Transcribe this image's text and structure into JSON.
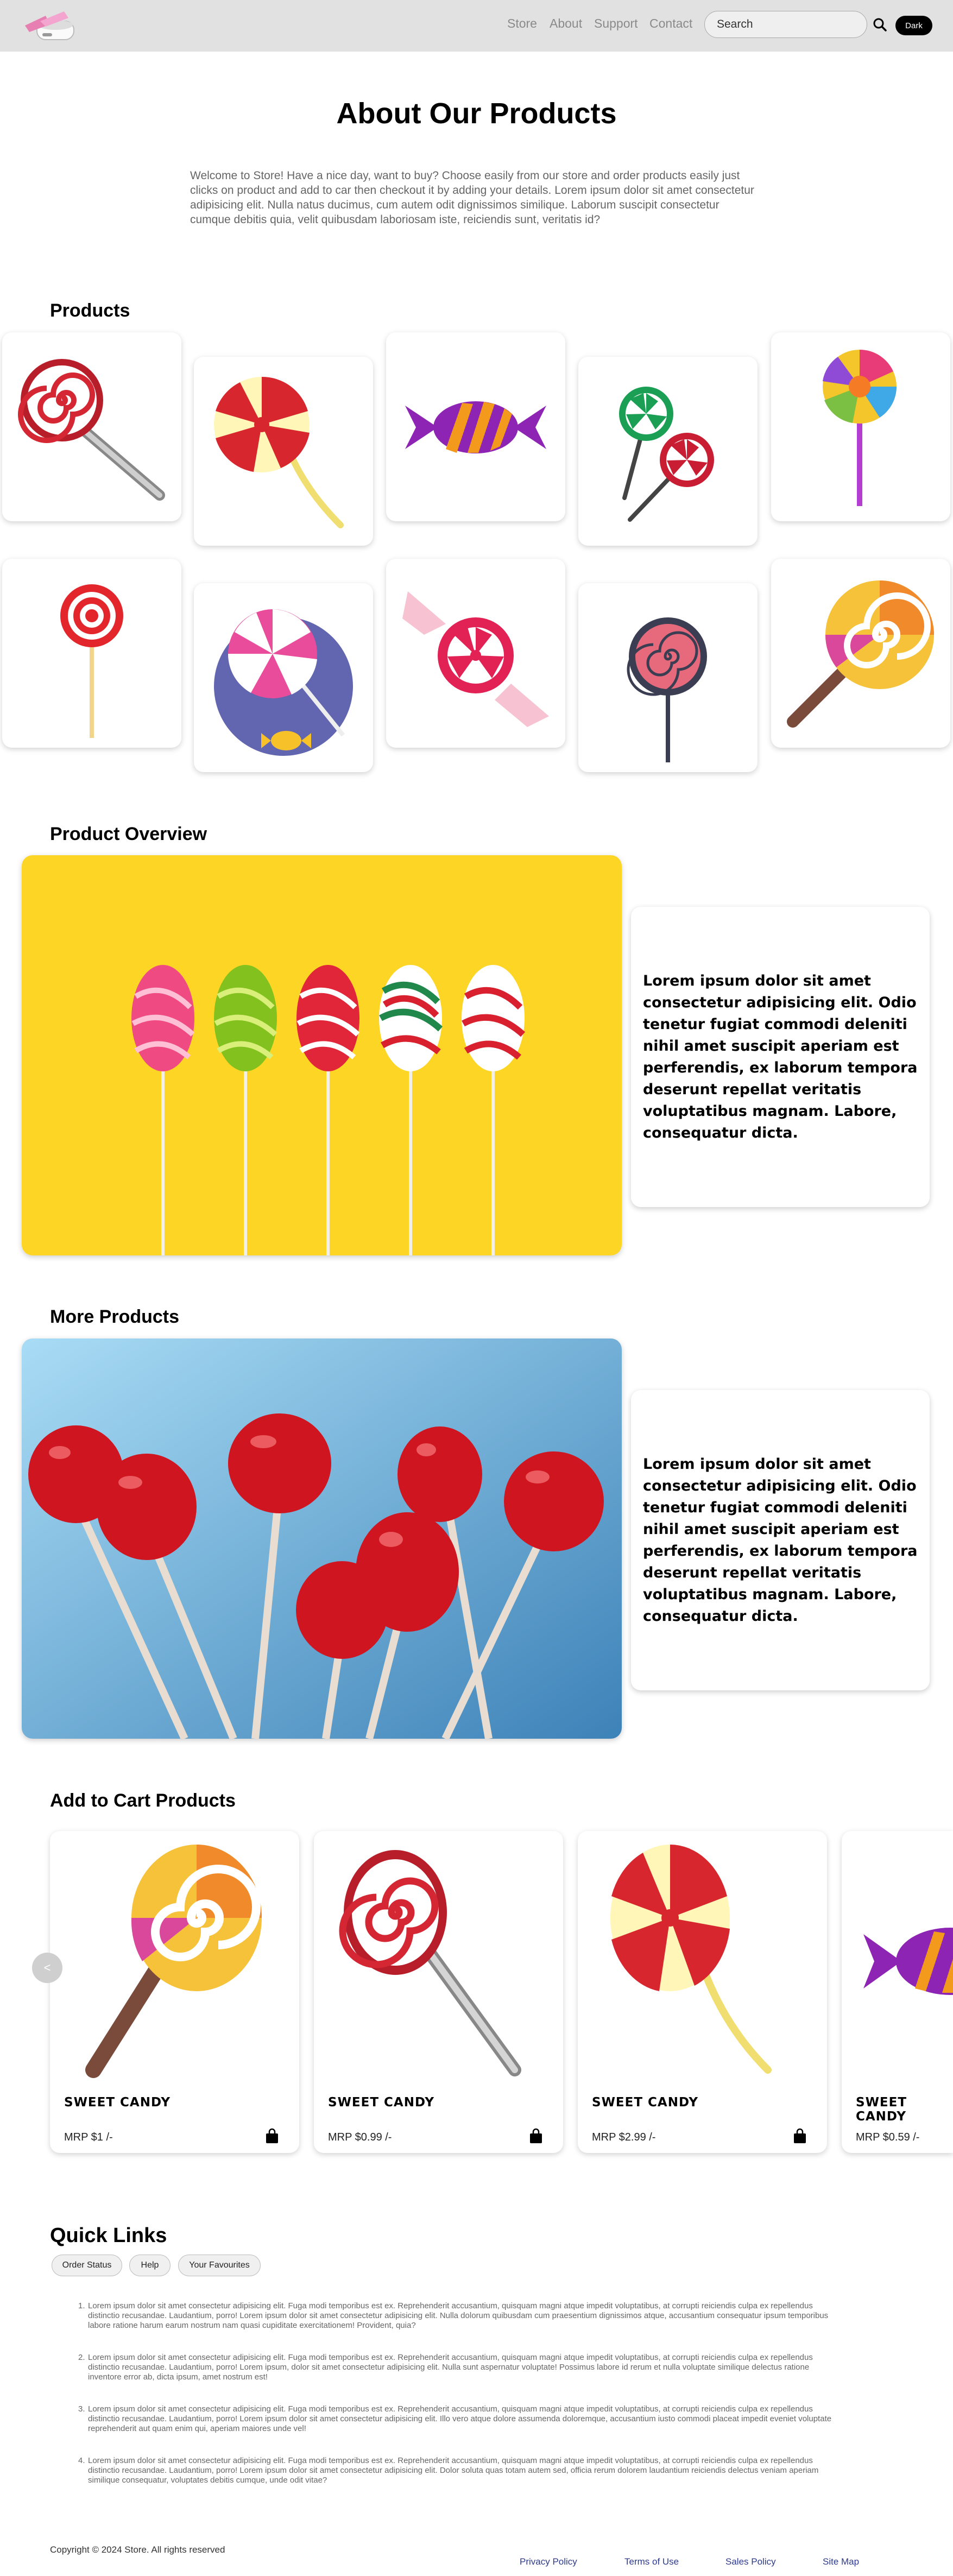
{
  "navbar": {
    "links": [
      "Store",
      "About",
      "Support",
      "Contact"
    ],
    "search_placeholder": "Search",
    "dark_label": "Dark",
    "logo_icon": "cart-logo-icon",
    "search_icon": "magnifier-icon"
  },
  "about": {
    "title": "About Our Products",
    "text": "Welcome to Store! Have a nice day, want to buy? Choose easily from our store and order products easily just clicks on product and add to car then checkout it by adding your details. Lorem ipsum dolor sit amet consectetur adipisicing elit. Nulla natus ducimus, cum autem odit dignissimos similique. Laborum suscipit consectetur cumque debitis quia, velit quibusdam laboriosam iste, reiciendis sunt, veritatis id?"
  },
  "products": {
    "title": "Products",
    "items": [
      "swirl-lollipop-large-icon",
      "yellow-red-swirl-lollipop-icon",
      "purple-wrapped-candy-icon",
      "green-red-lollipops-icon",
      "rainbow-lollipop-icon",
      "small-red-lollipop-icon",
      "pink-lollipop-plate-icon",
      "pink-wrapped-candy-icon",
      "dark-spiral-lollipop-icon",
      "orange-swirl-lollipop-icon"
    ]
  },
  "overview": {
    "title": "Product Overview",
    "text": "Lorem ipsum dolor sit amet consectetur adipisicing elit. Odio tenetur fugiat commodi deleniti nihil amet suscipit aperiam est perferendis, ex laborum tempora deserunt repellat veritatis voluptatibus magnam. Labore, consequatur dicta."
  },
  "more": {
    "title": "More Products",
    "text": "Lorem ipsum dolor sit amet consectetur adipisicing elit. Odio tenetur fugiat commodi deleniti nihil amet suscipit aperiam est perferendis, ex laborum tempora deserunt repellat veritatis voluptatibus magnam. Labore, consequatur dicta."
  },
  "cart": {
    "title": "Add to Cart Products",
    "prev_label": "<",
    "items": [
      {
        "name": "SWEET CANDY",
        "price": "MRP $1 /-"
      },
      {
        "name": "SWEET CANDY",
        "price": "MRP $0.99 /-"
      },
      {
        "name": "SWEET CANDY",
        "price": "MRP $2.99 /-"
      },
      {
        "name": "SWEET CANDY",
        "price": "MRP $0.59 /-"
      }
    ],
    "bag_icon": "shopping-bag-icon"
  },
  "quick_links": {
    "title": "Quick Links",
    "buttons": [
      "Order Status",
      "Help",
      "Your Favourites"
    ],
    "items": [
      "Lorem ipsum dolor sit amet consectetur adipisicing elit. Fuga modi temporibus est ex. Reprehenderit accusantium, quisquam magni atque impedit voluptatibus, at corrupti reiciendis culpa ex repellendus distinctio recusandae. Laudantium, porro! Lorem ipsum dolor sit amet consectetur adipisicing elit. Nulla dolorum quibusdam cum praesentium dignissimos atque, accusantium consequatur ipsum temporibus labore ratione harum earum nostrum nam quasi cupiditate exercitationem! Provident, quia?",
      "Lorem ipsum dolor sit amet consectetur adipisicing elit. Fuga modi temporibus est ex. Reprehenderit accusantium, quisquam magni atque impedit voluptatibus, at corrupti reiciendis culpa ex repellendus distinctio recusandae. Laudantium, porro! Lorem ipsum, dolor sit amet consectetur adipisicing elit. Nulla sunt aspernatur voluptate! Possimus labore id rerum et nulla voluptate similique delectus ratione inventore error ab, dicta ipsum, amet nostrum est!",
      "Lorem ipsum dolor sit amet consectetur adipisicing elit. Fuga modi temporibus est ex. Reprehenderit accusantium, quisquam magni atque impedit voluptatibus, at corrupti reiciendis culpa ex repellendus distinctio recusandae. Laudantium, porro! Lorem ipsum dolor sit amet consectetur adipisicing elit. Illo vero atque dolore assumenda doloremque, accusantium iusto commodi placeat impedit eveniet voluptate reprehenderit aut quam enim qui, aperiam maiores unde vel!",
      "Lorem ipsum dolor sit amet consectetur adipisicing elit. Fuga modi temporibus est ex. Reprehenderit accusantium, quisquam magni atque impedit voluptatibus, at corrupti reiciendis culpa ex repellendus distinctio recusandae. Laudantium, porro! Lorem ipsum dolor sit amet consectetur adipisicing elit. Dolor soluta quas totam autem sed, officia rerum dolorem laudantium reiciendis delectus veniam aperiam similique consequatur, voluptates debitis cumque, unde odit vitae?"
    ]
  },
  "footer": {
    "copyright": "Copyright © 2024 Store. All rights reserved",
    "links": [
      "Privacy Policy",
      "Terms of Use",
      "Sales Policy",
      "Site Map"
    ]
  }
}
